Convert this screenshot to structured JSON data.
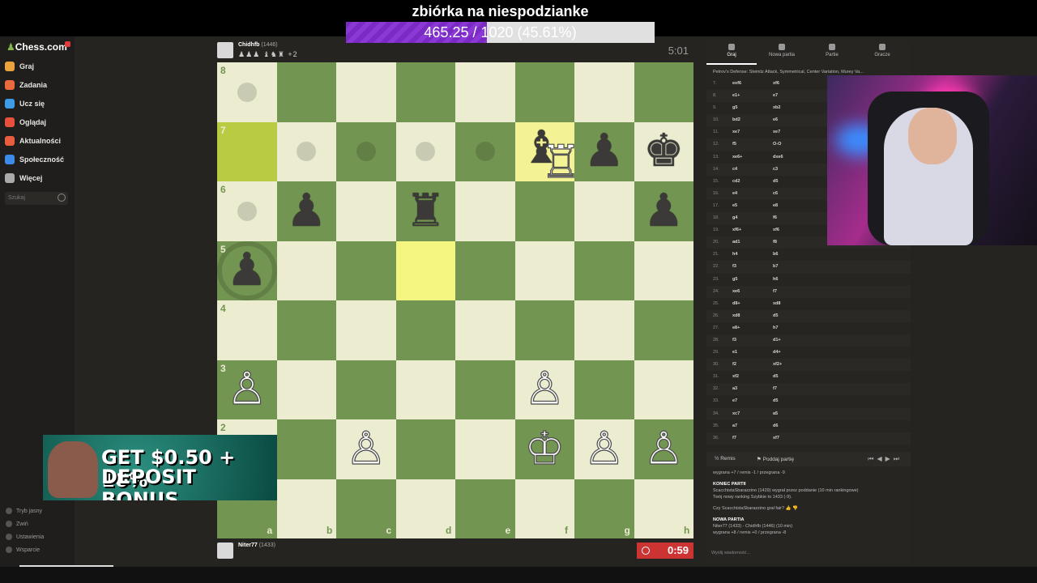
{
  "overlay": {
    "goal_title": "zbiórka na niespodzianke",
    "goal_text": "465.25 / 1020 (45.61%)",
    "goal_progress": 0.4561
  },
  "sidebar": {
    "logo": "Chess.com",
    "items": [
      {
        "label": "Graj",
        "color": "#e8a33d"
      },
      {
        "label": "Zadania",
        "color": "#e86a3d"
      },
      {
        "label": "Ucz się",
        "color": "#3d9be8"
      },
      {
        "label": "Oglądaj",
        "color": "#e8503d"
      },
      {
        "label": "Aktualności",
        "color": "#e85d3d"
      },
      {
        "label": "Społeczność",
        "color": "#3d8be8"
      },
      {
        "label": "Więcej",
        "color": "#aaaaaa"
      }
    ],
    "search_placeholder": "Szukaj",
    "bottom": [
      "Tryb jasny",
      "Zwiń",
      "Ustawienia",
      "Wsparcie"
    ]
  },
  "opponent": {
    "name": "Chidhfb",
    "rating": "(1446)",
    "captures": "♟♟♟ ♝♞♜ +2",
    "clock": "5:01"
  },
  "me": {
    "name": "Niter77",
    "rating": "(1433)",
    "clock": "0:59"
  },
  "board": {
    "files": [
      "a",
      "b",
      "c",
      "d",
      "e",
      "f",
      "g",
      "h"
    ],
    "ranks": [
      "8",
      "7",
      "6",
      "5",
      "4",
      "3",
      "2",
      "1"
    ],
    "pieces": [
      {
        "sq": "f7",
        "glyph": "♝",
        "color": "black"
      },
      {
        "sq": "f7",
        "glyph": "♖",
        "color": "white"
      },
      {
        "sq": "g7",
        "glyph": "♟",
        "color": "black"
      },
      {
        "sq": "h7",
        "glyph": "♚",
        "color": "black"
      },
      {
        "sq": "b6",
        "glyph": "♟",
        "color": "black"
      },
      {
        "sq": "d6",
        "glyph": "♜",
        "color": "black"
      },
      {
        "sq": "h6",
        "glyph": "♟",
        "color": "black"
      },
      {
        "sq": "a5",
        "glyph": "♟",
        "color": "black"
      },
      {
        "sq": "a3",
        "glyph": "♙",
        "color": "white"
      },
      {
        "sq": "f3",
        "glyph": "♙",
        "color": "white"
      },
      {
        "sq": "c2",
        "glyph": "♙",
        "color": "white"
      },
      {
        "sq": "f2",
        "glyph": "♔",
        "color": "white"
      },
      {
        "sq": "g2",
        "glyph": "♙",
        "color": "white"
      },
      {
        "sq": "h2",
        "glyph": "♙",
        "color": "white"
      }
    ],
    "highlight_last": [
      "a7",
      "d5"
    ],
    "highlight_select": [
      "f7"
    ],
    "hints": [
      "a8",
      "b7",
      "c7",
      "d7",
      "e7",
      "a6"
    ],
    "rings": [
      "a5"
    ]
  },
  "panel": {
    "tabs": [
      "Graj",
      "Nowa partia",
      "Partie",
      "Gracze"
    ],
    "opening": "Petrov's Defense: Steinitz Attack, Symmetrical, Center Variation, Murey Va...",
    "moves": [
      {
        "n": "7.",
        "w": "exf6",
        "b": "xf6"
      },
      {
        "n": "8.",
        "w": "e1+",
        "b": "e7"
      },
      {
        "n": "9.",
        "w": "g5",
        "b": "xb2"
      },
      {
        "n": "10.",
        "w": "bd2",
        "b": "e6"
      },
      {
        "n": "11.",
        "w": "xe7",
        "b": "xe7"
      },
      {
        "n": "12.",
        "w": "f5",
        "b": "O-O"
      },
      {
        "n": "13.",
        "w": "xe6+",
        "b": "dxe6"
      },
      {
        "n": "14.",
        "w": "c4",
        "b": "c3"
      },
      {
        "n": "15.",
        "w": "cd2",
        "b": "d5"
      },
      {
        "n": "16.",
        "w": "e4",
        "b": "c6"
      },
      {
        "n": "17.",
        "w": "e5",
        "b": "e8"
      },
      {
        "n": "18.",
        "w": "g4",
        "b": "f6"
      },
      {
        "n": "19.",
        "w": "xf6+",
        "b": "xf6"
      },
      {
        "n": "20.",
        "w": "ad1",
        "b": "f8"
      },
      {
        "n": "21.",
        "w": "h4",
        "b": "b6"
      },
      {
        "n": "22.",
        "w": "f3",
        "b": "b7"
      },
      {
        "n": "23.",
        "w": "g5",
        "b": "h6"
      },
      {
        "n": "24.",
        "w": "xe6",
        "b": "f7"
      },
      {
        "n": "25.",
        "w": "d8+",
        "b": "xd8"
      },
      {
        "n": "26.",
        "w": "xd8",
        "b": "d5"
      },
      {
        "n": "27.",
        "w": "e8+",
        "b": "h7"
      },
      {
        "n": "28.",
        "w": "f3",
        "b": "d1+"
      },
      {
        "n": "29.",
        "w": "e1",
        "b": "d4+"
      },
      {
        "n": "30.",
        "w": "f2",
        "b": "xf2+"
      },
      {
        "n": "31.",
        "w": "xf2",
        "b": "d5"
      },
      {
        "n": "32.",
        "w": "a3",
        "b": "f7"
      },
      {
        "n": "33.",
        "w": "e7",
        "b": "d5"
      },
      {
        "n": "34.",
        "w": "xc7",
        "b": "a5"
      },
      {
        "n": "35.",
        "w": "a7",
        "b": "d6"
      },
      {
        "n": "36.",
        "w": "f7",
        "b": "xf7"
      }
    ],
    "controls": {
      "draw": "Remis",
      "resign": "Poddaj partię"
    },
    "chat": {
      "line0": "wygrana +7 / remis -1 / przegrana -9",
      "end_title": "KONIEC PARTII",
      "end_line1": "ScacchistaSbarazzino (1429) wygrał przez poddanie (10 min rankingowe)",
      "end_line2": "Twój nowy ranking Szybkie to 1433 (-9).",
      "fair_q": "Czy ScacchistaSbarazzino grał fair?",
      "new_title": "NOWA PARTIA",
      "new_line1": "Niter77 (1433) - Chidhfb (1446) (10 min)",
      "new_line2": "wygrana +8 / remis +0 / przegrana -8"
    },
    "chat_placeholder": "Wyślij wiadomość..."
  },
  "ad": {
    "line1": "GET $0.50 + 10%",
    "line2": "DEPOSIT BONUS"
  }
}
